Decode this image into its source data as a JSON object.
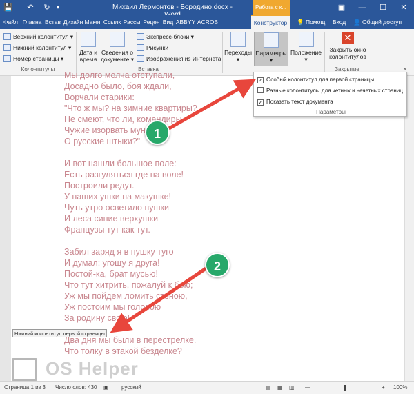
{
  "titlebar": {
    "title": "Михаил Лермонтов - Бородино.docx - Word",
    "context_title": "Работа с к...",
    "minimize": "—",
    "restore": "☐",
    "close": "✕",
    "ribbon_options": "▣"
  },
  "tabs": [
    "Файл",
    "Главна",
    "Встав",
    "Дизайн",
    "Макет",
    "Ссылк",
    "Рассы",
    "Рецен",
    "Вид",
    "ABBYY",
    "ACROB",
    "Конструктор"
  ],
  "tabs_right": {
    "tell_me": "Помощ",
    "signin": "Вход",
    "share": "Общий доступ"
  },
  "ribbon": {
    "headers_footers": {
      "header": "Верхний колонтитул",
      "footer": "Нижний колонтитул",
      "page_number": "Номер страницы",
      "label": "Колонтитулы"
    },
    "insert": {
      "datetime_line1": "Дата и",
      "datetime_line2": "время",
      "docinfo_line1": "Сведения о",
      "docinfo_line2": "документе",
      "quick_parts": "Экспресс-блоки",
      "pictures": "Рисунки",
      "online_pictures": "Изображения из Интернета",
      "label": "Вставка"
    },
    "navigation": {
      "label": "Переходы"
    },
    "options": {
      "label": "Параметры"
    },
    "position": {
      "label": "Положение"
    },
    "close": {
      "line1": "Закрыть окно",
      "line2": "колонтитулов",
      "label": "Закрытие"
    }
  },
  "dropdown": {
    "items": [
      {
        "label": "Особый колонтитул для первой страницы",
        "checked": true
      },
      {
        "label": "Разные колонтитулы для четных и нечетных страниц",
        "checked": false
      },
      {
        "label": "Показать текст документа",
        "checked": true
      }
    ],
    "title": "Параметры"
  },
  "document": {
    "lines": [
      "Мы долго молча отступали,",
      "Досадно было, боя ждали,",
      "Ворчали старики:",
      "\"Что ж мы? на зимние квартиры?",
      "Не смеют, что ли, командиры",
      "Чужие изорвать мундиры",
      "О русские штыки?\"",
      "",
      "И вот нашли большое поле:",
      "Есть разгуляться где на воле!",
      "Построили редут.",
      "У наших ушки на макушке!",
      "Чуть утро осветило пушки",
      "И леса синие верхушки -",
      "Французы тут как тут.",
      "",
      "Забил заряд я в пушку туго",
      "И думал: угощу я друга!",
      "Постой-ка, брат мусью!",
      "Что тут хитрить, пожалуй к бою;",
      "Уж мы пойдем ломить стеною,",
      "Уж постоим мы головою",
      "За родину свою!",
      "",
      "Два дня мы были в перестрелке.",
      "Что толку в этакой безделке?"
    ],
    "footer_tag": "Нижний колонтитул первой страницы"
  },
  "annotations": {
    "badge1": "1",
    "badge2": "2"
  },
  "watermark": {
    "text": "OS Helper"
  },
  "statusbar": {
    "page": "Страница 1 из 3",
    "words": "Число слов: 430",
    "language": "русский",
    "zoom": "100%"
  },
  "colors": {
    "word_blue": "#2b579a",
    "context_orange": "#f0a830",
    "poem_text": "#c9878f",
    "arrow_red": "#e8463c",
    "badge_green": "#27a86a"
  }
}
